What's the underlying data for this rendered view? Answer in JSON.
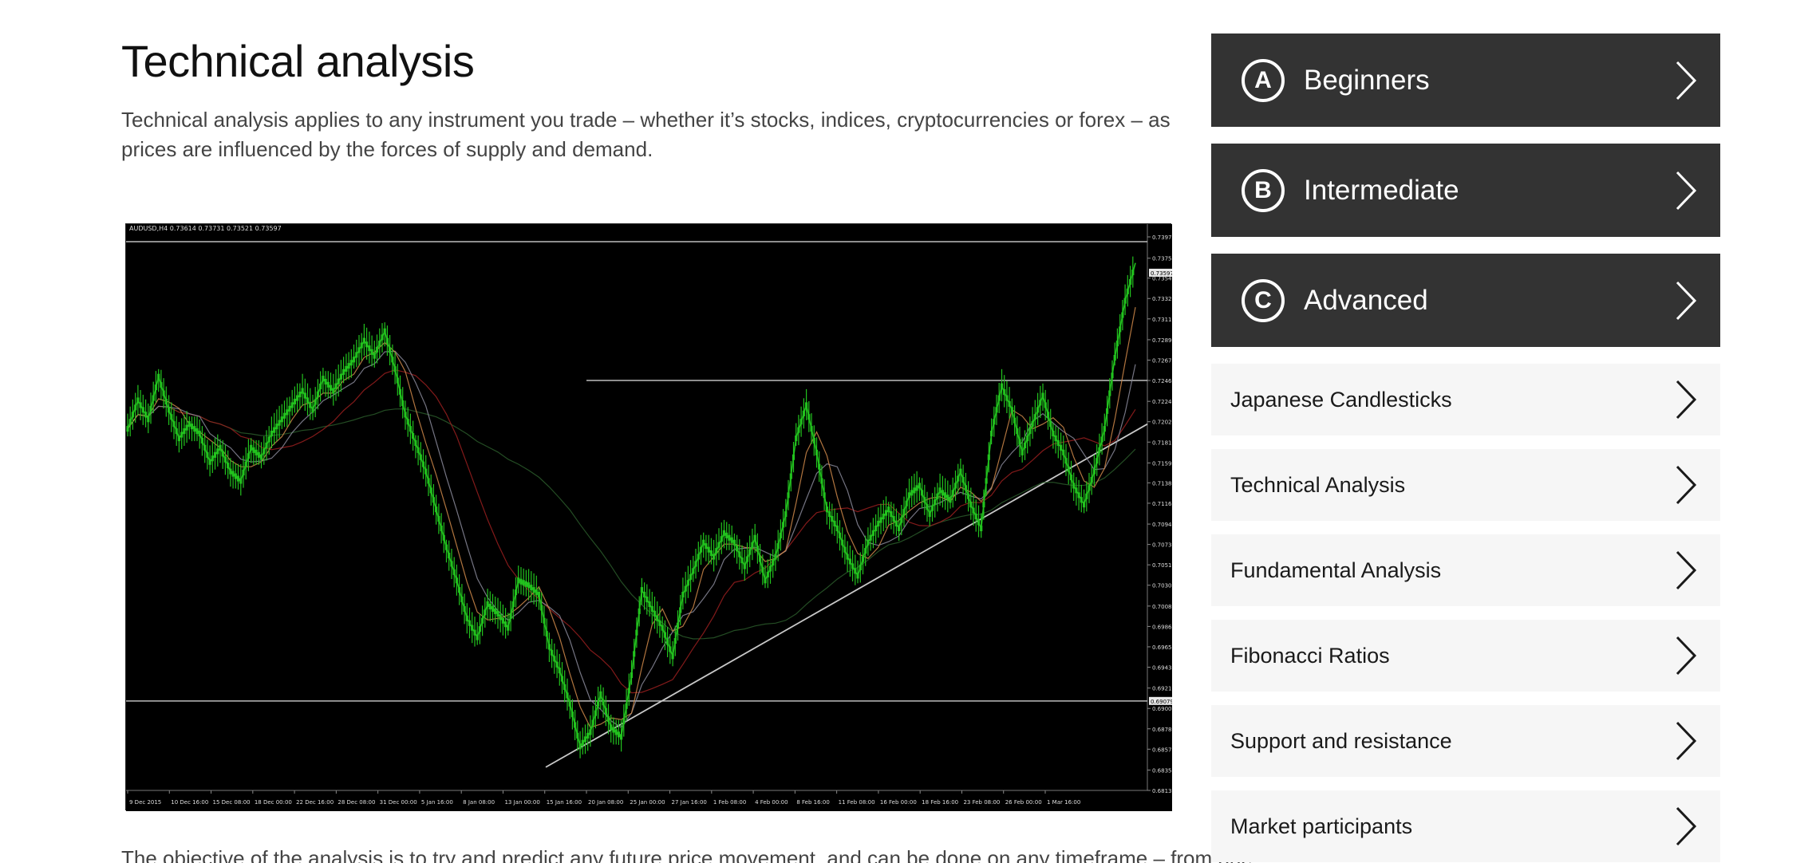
{
  "article": {
    "title": "Technical analysis",
    "intro": "Technical analysis applies to any instrument you trade – whether it’s stocks, indices, cryptocurrencies or forex – as prices are influenced by the forces of supply and demand.",
    "outro": "The objective of the analysis is to try and predict any future price movement, and can be done on any timeframe – from one"
  },
  "chart_data": {
    "type": "line",
    "header": "AUDUSD,H4  0.73614 0.73731 0.73521 0.73597",
    "x_tick_labels": [
      "9 Dec 2015",
      "10 Dec 16:00",
      "15 Dec 08:00",
      "18 Dec 00:00",
      "22 Dec 16:00",
      "28 Dec 08:00",
      "31 Dec 00:00",
      "5 Jan 16:00",
      "8 Jan 08:00",
      "13 Jan 00:00",
      "15 Jan 16:00",
      "20 Jan 08:00",
      "25 Jan 00:00",
      "27 Jan 16:00",
      "1 Feb 08:00",
      "4 Feb 00:00",
      "8 Feb 16:00",
      "11 Feb 08:00",
      "16 Feb 00:00",
      "18 Feb 16:00",
      "23 Feb 08:00",
      "26 Feb 00:00",
      "1 Mar 16:00"
    ],
    "y_tick_labels": [
      "0.73975",
      "0.73750",
      "0.73540",
      "0.73325",
      "0.73110",
      "0.72890",
      "0.72675",
      "0.72460",
      "0.72240",
      "0.72025",
      "0.71810",
      "0.71590",
      "0.71380",
      "0.71165",
      "0.70945",
      "0.70730",
      "0.70515",
      "0.70300",
      "0.70080",
      "0.69865",
      "0.69650",
      "0.69435",
      "0.69215",
      "0.69000",
      "0.68785",
      "0.68570",
      "0.68350",
      "0.68135"
    ],
    "current_price_label": "0.73597",
    "support_label": "0.69079",
    "ylim": [
      0.68135,
      0.73975
    ],
    "price": [
      0.7195,
      0.7225,
      0.7205,
      0.725,
      0.7215,
      0.7185,
      0.72,
      0.719,
      0.716,
      0.7175,
      0.715,
      0.714,
      0.7175,
      0.7165,
      0.719,
      0.7205,
      0.722,
      0.7235,
      0.7215,
      0.7248,
      0.7235,
      0.7255,
      0.7268,
      0.7288,
      0.7272,
      0.7298,
      0.7258,
      0.721,
      0.718,
      0.715,
      0.711,
      0.707,
      0.7035,
      0.6995,
      0.6975,
      0.701,
      0.7,
      0.6985,
      0.7035,
      0.703,
      0.702,
      0.6965,
      0.694,
      0.6905,
      0.686,
      0.6875,
      0.6915,
      0.688,
      0.687,
      0.6935,
      0.7025,
      0.7005,
      0.6985,
      0.6955,
      0.702,
      0.7045,
      0.7075,
      0.706,
      0.7085,
      0.7075,
      0.705,
      0.708,
      0.7035,
      0.706,
      0.7105,
      0.7185,
      0.722,
      0.717,
      0.711,
      0.709,
      0.706,
      0.704,
      0.7075,
      0.7095,
      0.711,
      0.709,
      0.7125,
      0.7135,
      0.7105,
      0.713,
      0.712,
      0.715,
      0.7115,
      0.709,
      0.719,
      0.724,
      0.7215,
      0.717,
      0.72,
      0.723,
      0.719,
      0.717,
      0.7135,
      0.7115,
      0.715,
      0.7195,
      0.727,
      0.733,
      0.737
    ],
    "resistance": 0.7246,
    "support": 0.69079,
    "trendline": [
      [
        0.41,
        0.6838
      ],
      [
        1.0,
        0.72
      ]
    ]
  },
  "sidebar": {
    "levels": [
      {
        "badge": "A",
        "label": "Beginners"
      },
      {
        "badge": "B",
        "label": "Intermediate"
      },
      {
        "badge": "C",
        "label": "Advanced"
      }
    ],
    "topics": [
      {
        "label": "Japanese Candlesticks"
      },
      {
        "label": "Technical Analysis"
      },
      {
        "label": "Fundamental Analysis"
      },
      {
        "label": "Fibonacci Ratios"
      },
      {
        "label": "Support and resistance"
      },
      {
        "label": "Market participants"
      }
    ]
  },
  "colors": {
    "level_bg": "#333333",
    "topic_bg": "#f6f6f6",
    "candle": "#22c21e",
    "ma_fast": "#d08a4a",
    "ma_mid": "#8a8a9a",
    "ma_slow": "#9a1f1f",
    "ma_long": "#2a5a2a",
    "level_line": "#bdbdbd"
  }
}
